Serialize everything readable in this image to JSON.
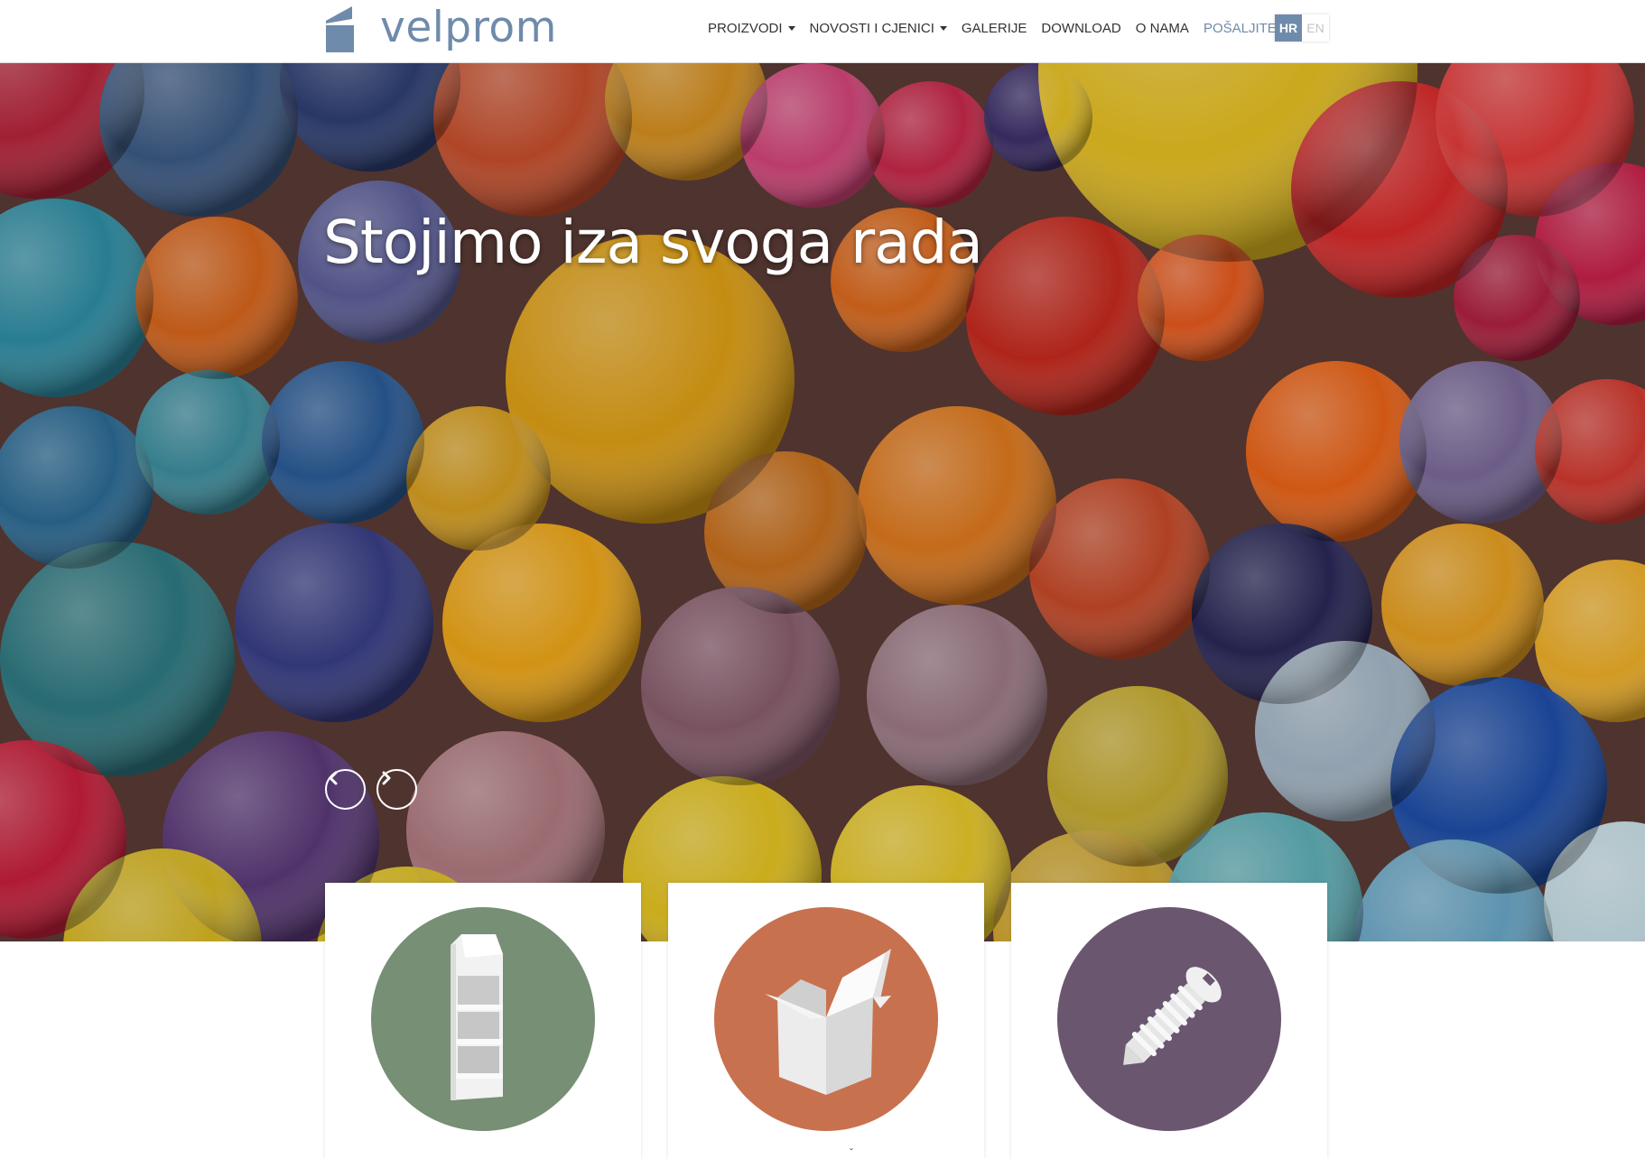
{
  "header": {
    "logo_text": "velprom",
    "nav": [
      {
        "label": "PROIZVODI",
        "dropdown": true
      },
      {
        "label": "NOVOSTI I CJENICI",
        "dropdown": true
      },
      {
        "label": "GALERIJE",
        "dropdown": false
      },
      {
        "label": "DOWNLOAD",
        "dropdown": false
      },
      {
        "label": "O NAMA",
        "dropdown": false
      },
      {
        "label": "POŠALJITE UPIT",
        "dropdown": false,
        "accent": true
      }
    ],
    "languages": [
      {
        "code": "HR",
        "active": true
      },
      {
        "code": "EN",
        "active": false
      }
    ]
  },
  "hero": {
    "title": "Stojimo iza svoga rada",
    "prev_icon": "chevron-left-icon",
    "next_icon": "chevron-right-icon"
  },
  "cards": [
    {
      "icon": "display-stand-icon",
      "color": "#778f74"
    },
    {
      "icon": "open-box-icon",
      "color": "#c8714f",
      "hint": "ˇ"
    },
    {
      "icon": "screw-icon",
      "color": "#6b5670"
    }
  ],
  "colors": {
    "accent": "#6f8bab",
    "text": "#333333"
  }
}
